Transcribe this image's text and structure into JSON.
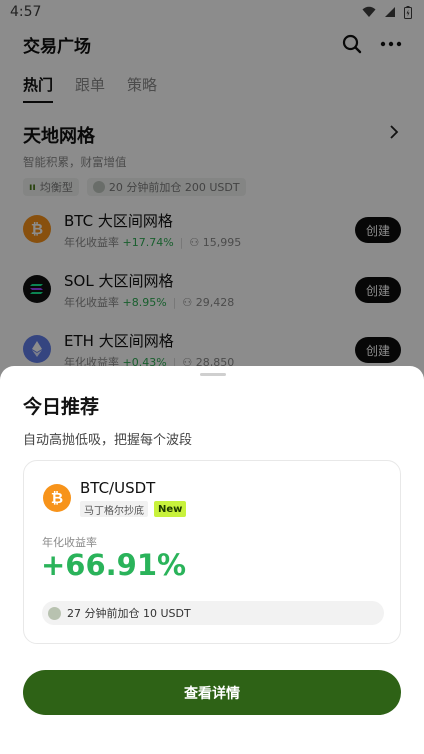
{
  "status_bar": {
    "time": "4:57"
  },
  "header": {
    "title": "交易广场"
  },
  "tabs": [
    {
      "label": "热门",
      "active": true
    },
    {
      "label": "跟单",
      "active": false
    },
    {
      "label": "策略",
      "active": false
    }
  ],
  "section": {
    "title": "天地网格",
    "subtitle": "智能积累，财富增值",
    "tag_type": "均衡型",
    "tag_activity": "20 分钟前加仓 200 USDT"
  },
  "strategies": [
    {
      "coin": "BTC",
      "name": "BTC 大区间网格",
      "rate_label": "年化收益率",
      "rate": "+17.74%",
      "users": "15,995",
      "action": "创建",
      "color": "#f7931a"
    },
    {
      "coin": "SOL",
      "name": "SOL 大区间网格",
      "rate_label": "年化收益率",
      "rate": "+8.95%",
      "users": "29,428",
      "action": "创建",
      "color": "#111111"
    },
    {
      "coin": "ETH",
      "name": "ETH 大区间网格",
      "rate_label": "年化收益率",
      "rate": "+0.43%",
      "users": "28,850",
      "action": "创建",
      "color": "#627eea"
    }
  ],
  "sheet": {
    "title": "今日推荐",
    "subtitle": "自动高抛低吸，把握每个波段",
    "card": {
      "pair": "BTC/USDT",
      "tag_strategy": "马丁格尔抄底",
      "tag_new": "New",
      "rate_label": "年化收益率",
      "rate": "+66.91%",
      "activity": "27 分钟前加仓 10 USDT"
    },
    "cta": "查看详情"
  },
  "colors": {
    "accent": "#2e6216",
    "positive": "#2ab35a",
    "new_badge": "#c8f23c"
  }
}
